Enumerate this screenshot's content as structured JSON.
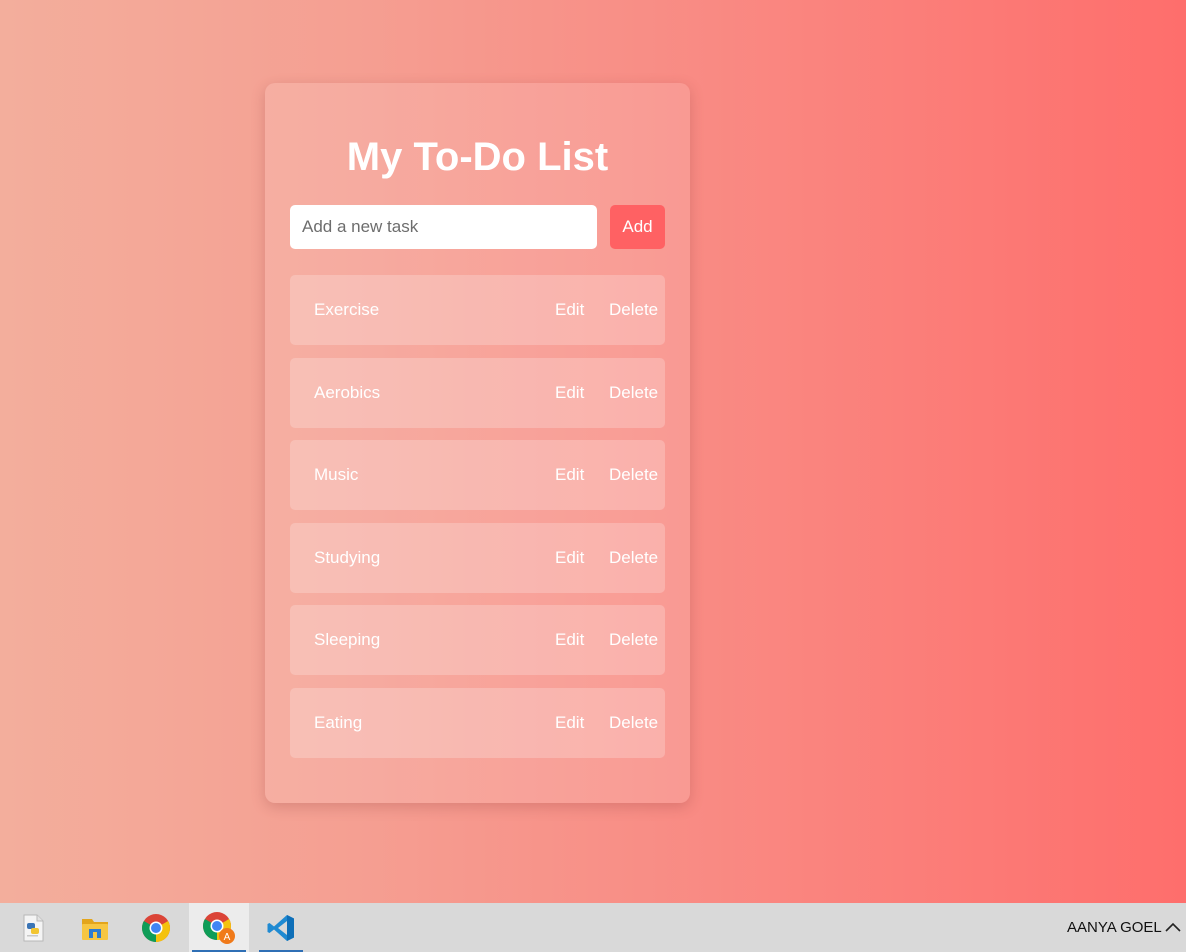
{
  "app": {
    "title": "My To-Do List"
  },
  "input": {
    "placeholder": "Add a new task",
    "value": ""
  },
  "add_button": {
    "label": "Add"
  },
  "tasks": [
    {
      "text": "Exercise",
      "edit_label": "Edit",
      "delete_label": "Delete"
    },
    {
      "text": "Aerobics",
      "edit_label": "Edit",
      "delete_label": "Delete"
    },
    {
      "text": "Music",
      "edit_label": "Edit",
      "delete_label": "Delete"
    },
    {
      "text": "Studying",
      "edit_label": "Edit",
      "delete_label": "Delete"
    },
    {
      "text": "Sleeping",
      "edit_label": "Edit",
      "delete_label": "Delete"
    },
    {
      "text": "Eating",
      "edit_label": "Edit",
      "delete_label": "Delete"
    }
  ],
  "taskbar": {
    "apps": [
      {
        "icon": "python-file-icon",
        "state": "idle"
      },
      {
        "icon": "file-explorer-icon",
        "state": "idle"
      },
      {
        "icon": "chrome-icon",
        "state": "idle"
      },
      {
        "icon": "chrome-profile-icon",
        "state": "active"
      },
      {
        "icon": "vscode-icon",
        "state": "running"
      }
    ],
    "user_name": "AANYA GOEL",
    "tray_icon": "chevron-up-icon"
  },
  "colors": {
    "gradient_start": "#f3ae9c",
    "gradient_end": "#fe6e6c",
    "add_button": "#ff6163",
    "text": "#ffffff"
  }
}
